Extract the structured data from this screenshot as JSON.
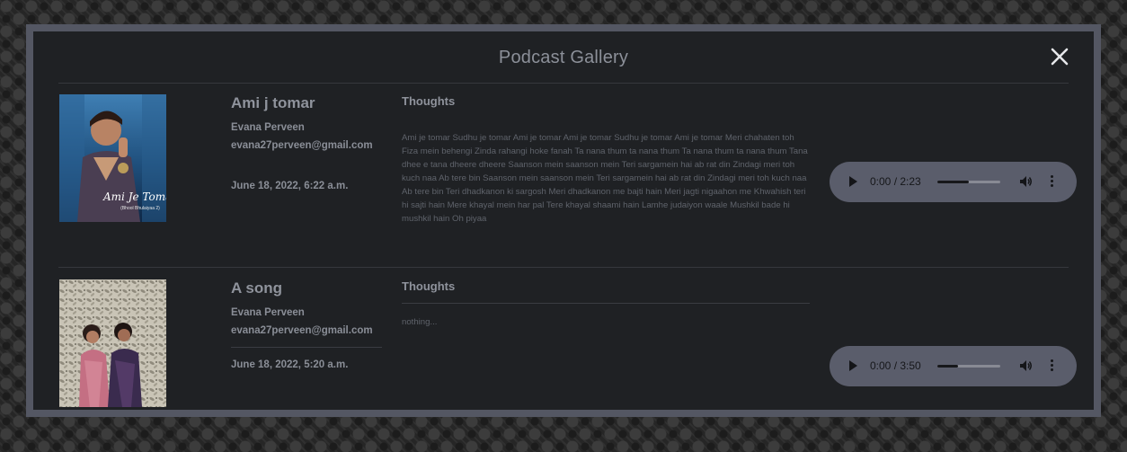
{
  "modal": {
    "title": "Podcast Gallery",
    "close_icon": "close-icon"
  },
  "podcasts": [
    {
      "title": "Ami j tomar",
      "author": "Evana Perveen",
      "email": "evana27perveen@gmail.com",
      "date": "June 18, 2022, 6:22 a.m.",
      "thoughts_label": "Thoughts",
      "thoughts": "Ami je tomar Sudhu je tomar Ami je tomar Ami je tomar Sudhu je tomar Ami je tomar Meri chahaten toh Fiza mein behengi Zinda rahangi hoke fanah Ta nana thum ta nana thum Ta nana thum ta nana thum Tana dhee e tana dheere dheere Saanson mein saanson mein Teri sargamein hai ab rat din Zindagi meri toh kuch naa Ab tere bin Saanson mein saanson mein Teri sargamein hai ab rat din Zindagi meri toh kuch naa Ab tere bin Teri dhadkanon ki sargosh Meri dhadkanon me bajti hain Meri jagti nigaahon me Khwahish teri hi sajti hain Mere khayal mein har pal Tere khayal shaami hain Lamhe judaiyon waale Mushkil bade hi mushkil hain Oh piyaa",
      "cover_text_main": "Ami Je Tomar",
      "cover_text_sub": "(Bhool Bhulaiyaa 2)",
      "audio": {
        "time": "0:00 / 2:23",
        "progress": 0.5,
        "play_icon": "play-icon",
        "volume_icon": "volume-icon",
        "more_icon": "more-options-icon"
      }
    },
    {
      "title": "A song",
      "author": "Evana Perveen",
      "email": "evana27perveen@gmail.com",
      "date": "June 18, 2022, 5:20 a.m.",
      "thoughts_label": "Thoughts",
      "thoughts": "nothing...",
      "audio": {
        "time": "0:00 / 3:50",
        "progress": 0.33,
        "play_icon": "play-icon",
        "volume_icon": "volume-icon",
        "more_icon": "more-options-icon"
      }
    }
  ],
  "colors": {
    "panel": "#1f2124",
    "border": "#545763",
    "player": "#5a5d6b",
    "text": "#8f939c"
  }
}
